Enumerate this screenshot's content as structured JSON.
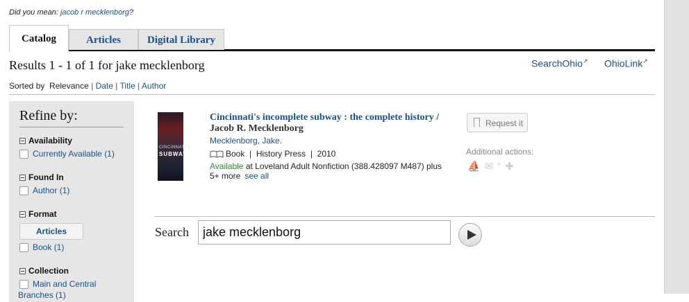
{
  "didyoumean": {
    "prefix": "Did you mean: ",
    "suggestion": "jacob r mecklenborg",
    "suffix": "?"
  },
  "tabs": [
    "Catalog",
    "Articles",
    "Digital Library"
  ],
  "results": {
    "title": "Results 1 - 1 of 1 for jake mecklenborg"
  },
  "external_links": [
    {
      "label": "SearchOhio",
      "icon": "external-link-icon"
    },
    {
      "label": "OhioLink",
      "icon": "external-link-icon"
    }
  ],
  "sort": {
    "prefix": "Sorted by",
    "current": "Relevance",
    "sep": "|",
    "options": [
      "Date",
      "Title",
      "Author"
    ]
  },
  "refine": {
    "title": "Refine by:",
    "availability": {
      "heading": "Availability",
      "option": "Currently Available",
      "count": "(1)"
    },
    "found_in": {
      "heading": "Found In",
      "option": "Author",
      "count": "(1)"
    },
    "format": {
      "heading": "Format",
      "button": "Articles",
      "option": "Book",
      "count": "(1)"
    },
    "collection": {
      "heading": "Collection",
      "option": "Main and Central",
      "option_cont": "Branches",
      "count": "(1)"
    }
  },
  "record": {
    "cover_line1": "CINCINNATI'S",
    "cover_line2": "SUBWAY",
    "title": "Cincinnati's incomplete subway : the complete history",
    "title_author": "/ Jacob R. Mecklenborg",
    "author": "Mecklenborg, Jake.",
    "format": "Book",
    "sep": "|",
    "publisher": "History Press",
    "year": "2010",
    "available_word": "Available",
    "location": "at Loveland Adult Nonfiction (388.428097 M487) plus 5+ more",
    "see_all": "see all",
    "request_label": "Request it",
    "additional_actions": "Additional actions:",
    "action_icons": [
      "basket-icon",
      "email-icon",
      "cite-icon",
      "add-icon"
    ]
  },
  "search": {
    "label": "Search",
    "value": "jake mecklenborg"
  }
}
